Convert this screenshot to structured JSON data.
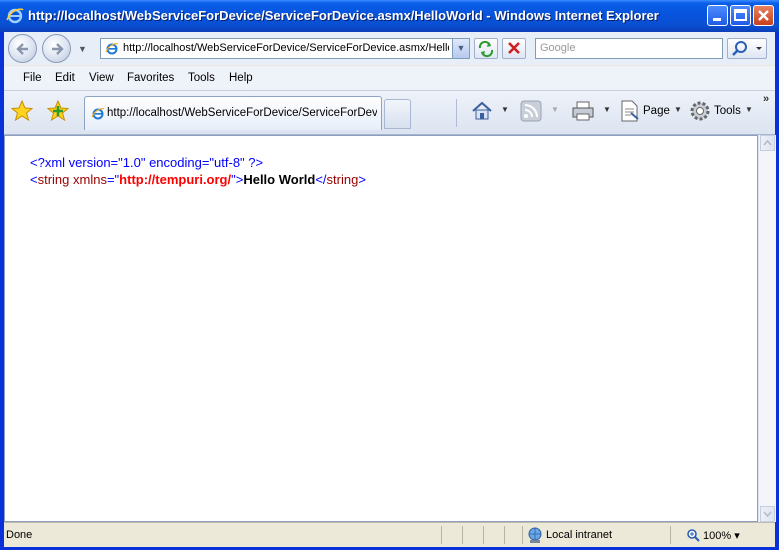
{
  "window": {
    "title": "http://localhost/WebServiceForDevice/ServiceForDevice.asmx/HelloWorld - Windows Internet Explorer"
  },
  "address_bar": {
    "url": "http://localhost/WebServiceForDevice/ServiceForDevice.asmx/Hello"
  },
  "search": {
    "placeholder": "Google"
  },
  "menu": {
    "items": [
      "File",
      "Edit",
      "View",
      "Favorites",
      "Tools",
      "Help"
    ]
  },
  "tab": {
    "label": "http://localhost/WebServiceForDevice/ServiceForDevi..."
  },
  "commands": {
    "page_label": "Page",
    "tools_label": "Tools",
    "chevron": "»"
  },
  "document": {
    "xml_decl": "<?xml version=\"1.0\" encoding=\"utf-8\" ?>",
    "open_bracket": "<",
    "tag_name": "string",
    "attr_name": " xmlns",
    "equals_quote": "=\"",
    "attr_value": "http://tempuri.org/",
    "close_quote": "\">",
    "text_content": "Hello World",
    "close_tag_open": "</",
    "close_tag_name": "string",
    "close_tag_end": ">"
  },
  "status": {
    "text": "Done",
    "zone": "Local intranet",
    "zoom": "100%",
    "zoom_drop": "▾"
  },
  "colors": {
    "titlebar": "#0a5ee8",
    "xml_blue": "#0000ff",
    "xml_tag": "#990000",
    "xml_value": "#ff0000"
  }
}
